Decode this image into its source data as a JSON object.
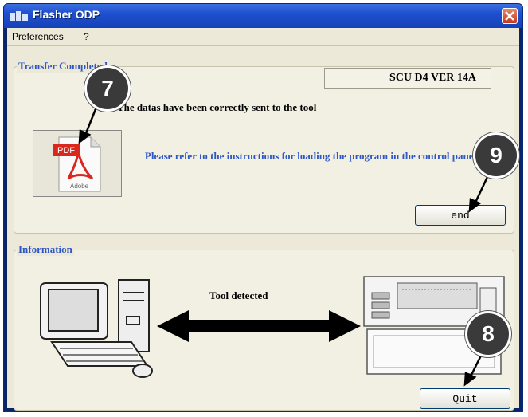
{
  "window": {
    "title": "Flasher ODP",
    "icon": "app-icon",
    "close_icon": "close-icon"
  },
  "menu": {
    "items": [
      "Preferences",
      "?"
    ]
  },
  "transfer": {
    "group_title": "Transfer Completed",
    "version": "SCU D4 VER  14A",
    "message_1": "The datas have been correctly sent to the tool",
    "message_2": "Please refer to the instructions for loading  the program in the control panel",
    "pdf_icon": "pdf-document-icon",
    "end_button": "end"
  },
  "information": {
    "group_title": "Information",
    "status": "Tool detected",
    "computer_icon": "computer-icon",
    "device_icon": "control-panel-device-icon",
    "arrow_icon": "double-arrow-icon",
    "quit_button": "Quit"
  },
  "callouts": [
    "7",
    "9",
    "8"
  ]
}
